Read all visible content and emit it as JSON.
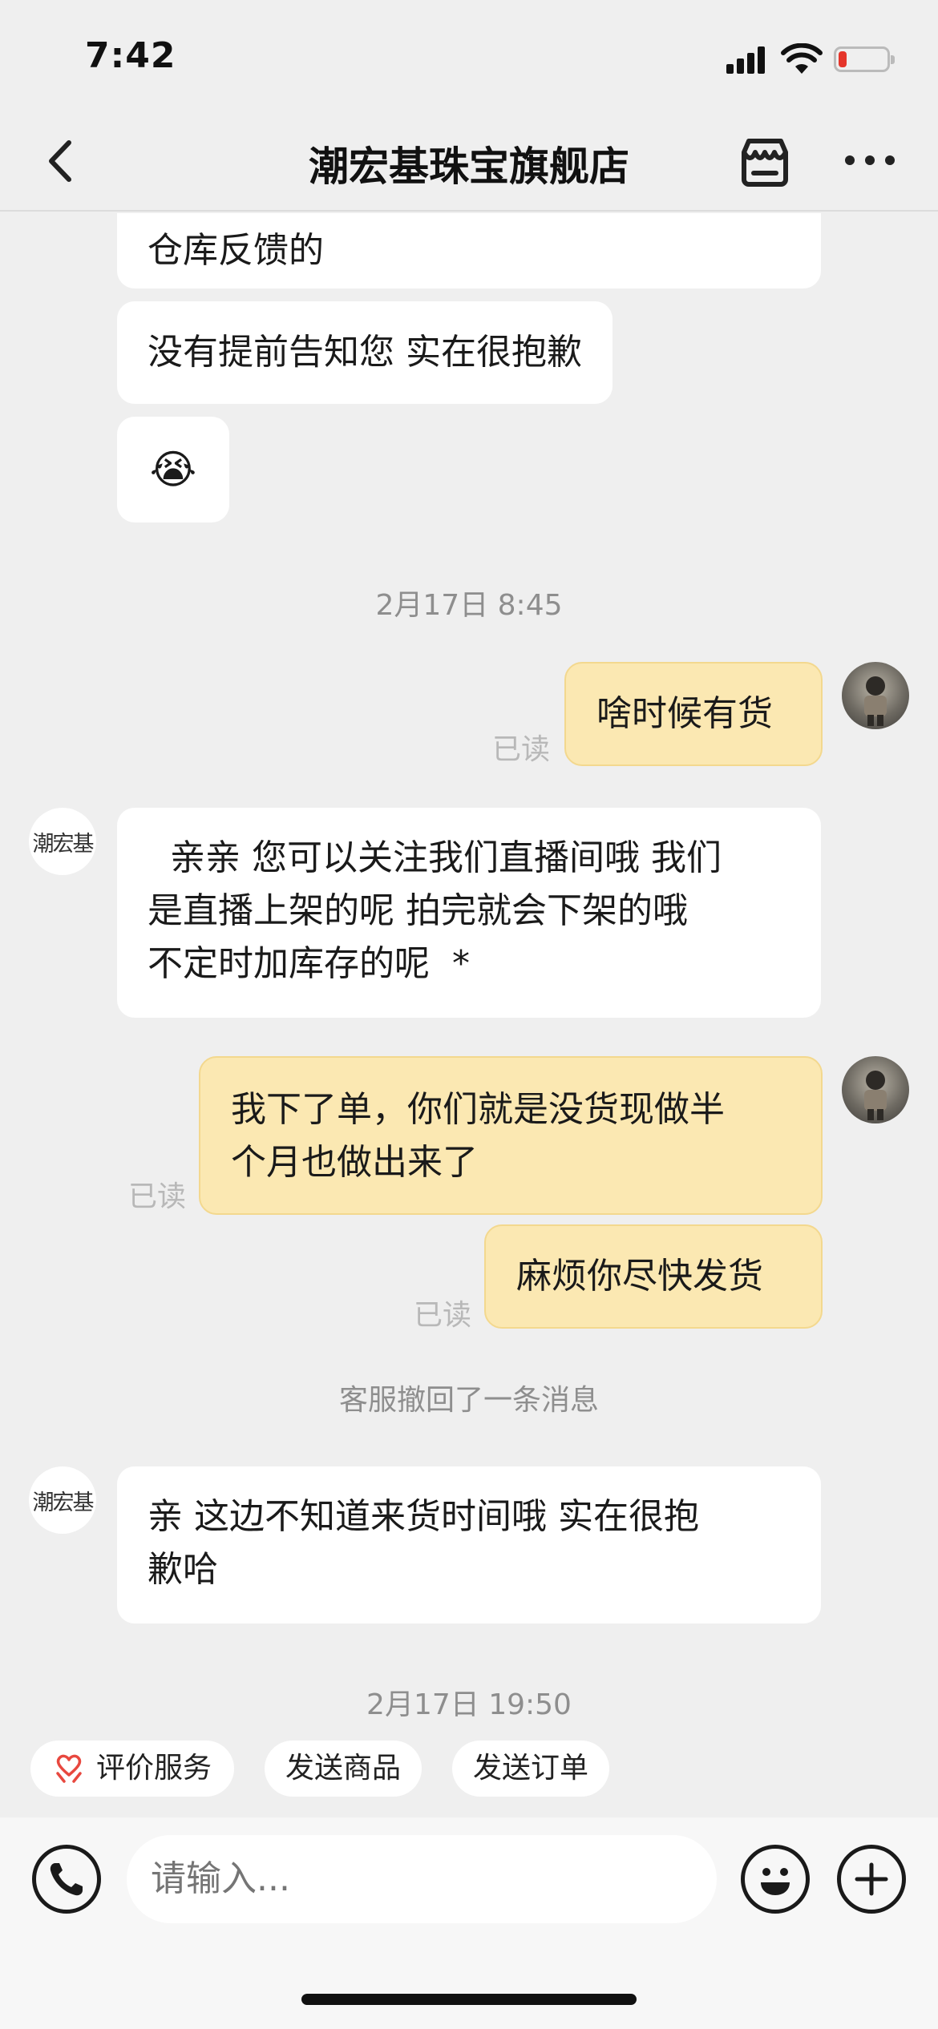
{
  "status_bar": {
    "time": "7:42",
    "battery_level": 0.18,
    "battery_color": "#e5352a"
  },
  "nav": {
    "title": "潮宏基珠宝旗舰店",
    "back_icon": "chevron-left-icon",
    "shop_icon": "storefront-icon",
    "more_icon": "more-dots-icon"
  },
  "shop_avatar_text": "潮宏基",
  "messages": [
    {
      "from": "shop",
      "text": "仓库反馈的"
    },
    {
      "from": "shop",
      "text": "没有提前告知您 实在很抱歉"
    },
    {
      "from": "shop",
      "text": "😭"
    },
    {
      "type": "time",
      "text": "2月17日 8:45"
    },
    {
      "from": "user",
      "text": "啥时候有货",
      "status": "已读"
    },
    {
      "from": "shop",
      "lines": [
        "  亲亲 您可以关注我们直播间哦 我们",
        "是直播上架的呢 拍完就会下架的哦",
        "不定时加库存的呢  *"
      ]
    },
    {
      "from": "user",
      "lines": [
        "我下了单，你们就是没货现做半",
        "个月也做出来了"
      ],
      "status": "已读"
    },
    {
      "from": "user",
      "text": "麻烦你尽快发货",
      "status": "已读"
    },
    {
      "type": "notice",
      "text": "客服撤回了一条消息"
    },
    {
      "from": "shop",
      "lines": [
        "亲 这边不知道来货时间哦 实在很抱",
        "歉哈"
      ]
    },
    {
      "type": "time",
      "text": "2月17日 19:50"
    }
  ],
  "quick_actions": [
    {
      "label": "评价服务",
      "icon": "heart-hands-icon",
      "icon_color": "#e8483f"
    },
    {
      "label": "发送商品"
    },
    {
      "label": "发送订单"
    }
  ],
  "input": {
    "placeholder": "请输入..."
  },
  "input_icons": [
    "phone-icon",
    "emoji-icon",
    "plus-icon"
  ],
  "colors": {
    "background": "#efefef",
    "user_bubble": "#fbe8b2",
    "shop_bubble": "#ffffff"
  }
}
